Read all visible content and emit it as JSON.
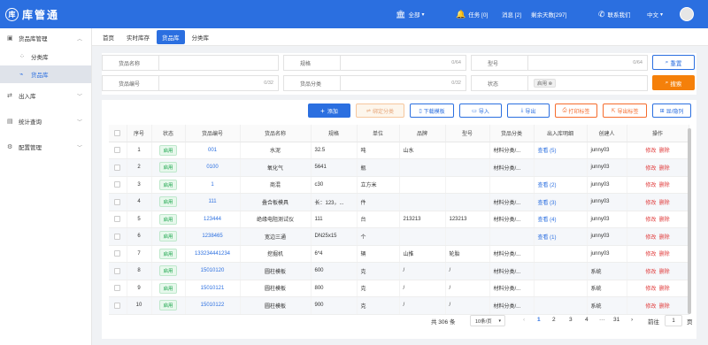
{
  "app": {
    "logo_mark": "库",
    "name": "库管通"
  },
  "header": {
    "scope_label": "全部",
    "task_label": "任务 [0]",
    "message_label": "消息 [2]",
    "remaining_label": "剩余天数[297]",
    "contact_label": "联系我们",
    "language_label": "中文",
    "accent_color": "#2b6fe0"
  },
  "sidebar": {
    "items": [
      {
        "label": "货品库管理",
        "icon": "cube-icon"
      },
      {
        "label": "分类库",
        "icon": "grid-icon"
      },
      {
        "label": "货品库",
        "icon": "tag-icon"
      },
      {
        "label": "出入库",
        "icon": "swap-icon"
      },
      {
        "label": "统计查询",
        "icon": "chart-icon"
      },
      {
        "label": "配置管理",
        "icon": "settings-icon"
      }
    ]
  },
  "tabs": [
    "首页",
    "实时库存",
    "货品库",
    "分类库"
  ],
  "filters": {
    "name_label": "货品名称",
    "spec_label": "规格",
    "spec_count": "0/64",
    "model_label": "型号",
    "model_count": "0/64",
    "code_label": "货品编号",
    "code_count": "0/32",
    "category_label": "货品分类",
    "category_count": "0/32",
    "status_label": "状态",
    "status_value": "启用",
    "reset_label": "重置",
    "search_label": "搜索"
  },
  "toolbar": {
    "add": "添加",
    "bind": "绑定分类",
    "download_template": "下载模板",
    "import": "导入",
    "export": "导出",
    "print_label": "打印标签",
    "export_label": "导出标签",
    "columns": "显/隐列"
  },
  "table": {
    "headers": [
      "",
      "序号",
      "状态",
      "货品编号",
      "货品名称",
      "规格",
      "单位",
      "品牌",
      "型号",
      "货品分类",
      "出入库明细",
      "创建人",
      "操作"
    ],
    "rows": [
      {
        "idx": "1",
        "status": "启用",
        "code": "001",
        "name": "水泥",
        "spec": "32.5",
        "unit": "吨",
        "brand": "山水",
        "model": "",
        "category": "材料分类/...",
        "detail": "查看 (5)",
        "creator": "junny03"
      },
      {
        "idx": "2",
        "status": "启用",
        "code": "0100",
        "name": "氧化气",
        "spec": "5641",
        "unit": "瓶",
        "brand": "",
        "model": "",
        "category": "材料分类/...",
        "detail": "",
        "creator": "junny03"
      },
      {
        "idx": "3",
        "status": "启用",
        "code": "1",
        "name": "商混",
        "spec": "c30",
        "unit": "立方米",
        "brand": "",
        "model": "",
        "category": "",
        "detail": "查看 (2)",
        "creator": "junny03"
      },
      {
        "idx": "4",
        "status": "启用",
        "code": "111",
        "name": "叠合板模具",
        "spec": "长：123，...",
        "unit": "件",
        "brand": "",
        "model": "",
        "category": "材料分类/...",
        "detail": "查看 (3)",
        "creator": "junny03"
      },
      {
        "idx": "5",
        "status": "启用",
        "code": "123444",
        "name": "绝缘电阻测试仪",
        "spec": "111",
        "unit": "台",
        "brand": "213213",
        "model": "123213",
        "category": "材料分类/...",
        "detail": "查看 (4)",
        "creator": "junny03"
      },
      {
        "idx": "6",
        "status": "启用",
        "code": "1238465",
        "name": "宽边三通",
        "spec": "DN25x15",
        "unit": "个",
        "brand": "",
        "model": "",
        "category": "",
        "detail": "查看 (1)",
        "creator": "junny03"
      },
      {
        "idx": "7",
        "status": "启用",
        "code": "133234441234",
        "name": "挖掘机",
        "spec": "6*4",
        "unit": "辆",
        "brand": "山推",
        "model": "轮胎",
        "category": "材料分类/...",
        "detail": "",
        "creator": "junny03"
      },
      {
        "idx": "8",
        "status": "启用",
        "code": "15010120",
        "name": "圆柱模板",
        "spec": "600",
        "unit": "克",
        "brand": "/",
        "model": "/",
        "category": "材料分类/...",
        "detail": "",
        "creator": "系统"
      },
      {
        "idx": "9",
        "status": "启用",
        "code": "15010121",
        "name": "圆柱模板",
        "spec": "800",
        "unit": "克",
        "brand": "/",
        "model": "/",
        "category": "材料分类/...",
        "detail": "",
        "creator": "系统"
      },
      {
        "idx": "10",
        "status": "启用",
        "code": "15010122",
        "name": "圆柱模板",
        "spec": "900",
        "unit": "克",
        "brand": "/",
        "model": "/",
        "category": "材料分类/...",
        "detail": "",
        "creator": "系统"
      }
    ],
    "edit_label": "修改",
    "delete_label": "删除"
  },
  "pagination": {
    "total": "共 306 条",
    "page_size": "10条/页",
    "pages": [
      "1",
      "2",
      "3",
      "4",
      "···",
      "31"
    ],
    "goto_label": "前往",
    "goto_value": "1",
    "page_unit": "页"
  }
}
